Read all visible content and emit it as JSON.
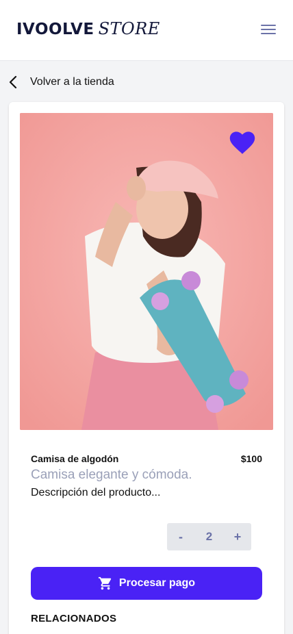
{
  "header": {
    "brand_main": "IVOOLVE",
    "brand_sub": "STORE"
  },
  "nav": {
    "back_label": "Volver a la tienda"
  },
  "product": {
    "name": "Camisa de algodón",
    "price": "$100",
    "tagline": "Camisa elegante y cómoda.",
    "description": "Descripción del producto...",
    "favorite": true,
    "image_alt_icon": "product-photo"
  },
  "quantity": {
    "decrement_label": "-",
    "value": "2",
    "increment_label": "+"
  },
  "checkout": {
    "button_label": "Procesar pago",
    "icon": "cart-icon"
  },
  "related": {
    "heading": "RELACIONADOS"
  },
  "colors": {
    "accent": "#4a22f5",
    "brand_text": "#13183a",
    "muted": "#9aa0b8",
    "photo_background": "#f3a6a4"
  }
}
